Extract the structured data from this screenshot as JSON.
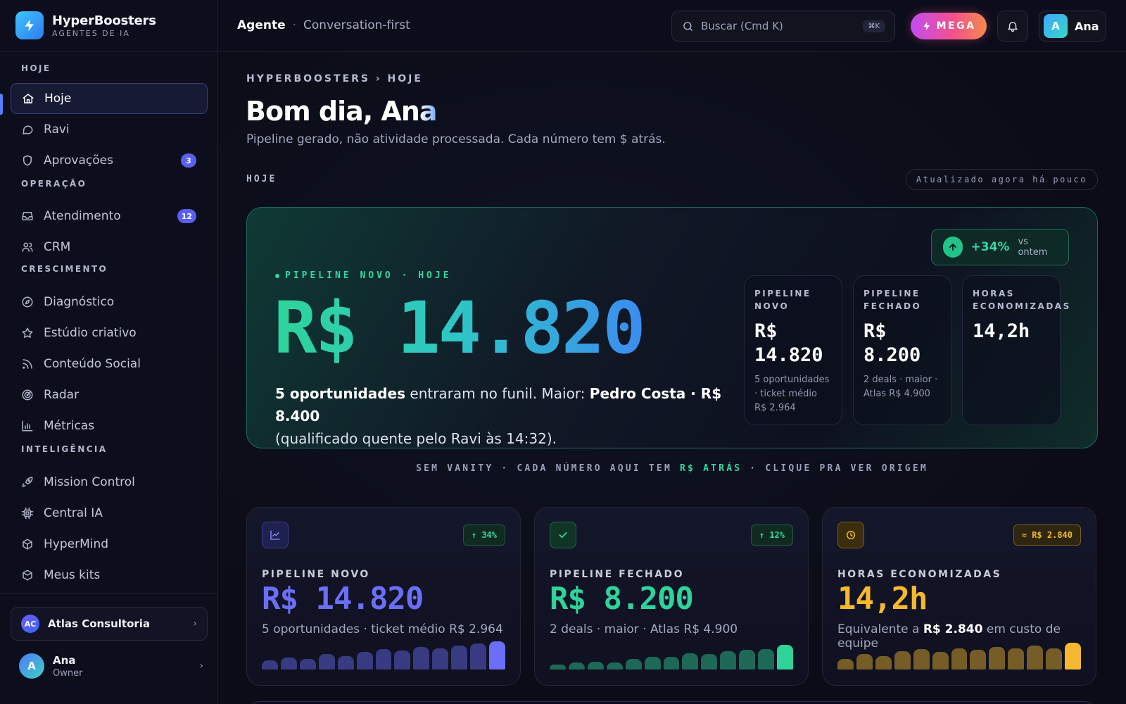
{
  "app": {
    "name": "HyperBoosters",
    "tagline": "AGENTES DE IA"
  },
  "sidebar": {
    "sections": [
      {
        "label": "HOJE"
      },
      {
        "label": "OPERAÇÃO"
      },
      {
        "label": "CRESCIMENTO"
      },
      {
        "label": "INTELIGÊNCIA"
      }
    ],
    "items": [
      {
        "label": "Hoje",
        "icon": "home-icon",
        "active": true
      },
      {
        "label": "Ravi",
        "icon": "chat-bubble-icon"
      },
      {
        "label": "Aprovações",
        "icon": "shield-icon",
        "badge": "3"
      },
      {
        "label": "Atendimento",
        "icon": "inbox-icon",
        "badge": "12"
      },
      {
        "label": "CRM",
        "icon": "users-icon"
      },
      {
        "label": "Diagnóstico",
        "icon": "compass-icon"
      },
      {
        "label": "Estúdio criativo",
        "icon": "star-icon"
      },
      {
        "label": "Conteúdo Social",
        "icon": "rss-icon"
      },
      {
        "label": "Radar",
        "icon": "radar-icon"
      },
      {
        "label": "Métricas",
        "icon": "bar-chart-icon"
      },
      {
        "label": "Mission Control",
        "icon": "rocket-icon"
      },
      {
        "label": "Central IA",
        "icon": "cpu-icon"
      },
      {
        "label": "HyperMind",
        "icon": "cube-icon"
      },
      {
        "label": "Meus kits",
        "icon": "box-icon"
      }
    ],
    "workspace": {
      "initials": "AC",
      "name": "Atlas Consultoria"
    },
    "user": {
      "initial": "A",
      "name": "Ana",
      "role": "Owner"
    }
  },
  "topbar": {
    "title": "Agente",
    "separator": "·",
    "mode": "Conversation-first",
    "search_placeholder": "Buscar (Cmd K)",
    "search_shortcut": "⌘K",
    "mega_label": "MEGA",
    "user_initial": "A",
    "user_name": "Ana"
  },
  "main": {
    "breadcrumb": "HYPERBOOSTERS › HOJE",
    "greeting_prefix": "Bom dia, An",
    "greeting_suffix": "a",
    "subtitle": "Pipeline gerado, não atividade processada. Cada número tem $ atrás.",
    "section_label": "HOJE",
    "updated": "Atualizado agora há pouco"
  },
  "hero": {
    "label": "PIPELINE NOVO · HOJE",
    "value": "R$ 14.820",
    "change_value": "+34%",
    "change_label": "vs ontem",
    "desc_count": "5 oportunidades",
    "desc_mid": " entraram no funil. Maior: ",
    "desc_top": "Pedro Costa · R$ 8.400",
    "desc_end": "(qualificado quente pelo Ravi às 14:32).",
    "stats": [
      {
        "title": "PIPELINE NOVO",
        "value": "R$ 14.820",
        "desc": "5 oportunidades · ticket médio R$ 2.964"
      },
      {
        "title": "PIPELINE FECHADO",
        "value": "R$ 8.200",
        "desc": "2 deals · maior · Atlas R$ 4.900"
      },
      {
        "title": "HORAS ECONOMIZADAS",
        "value": "14,2h",
        "desc": ""
      }
    ]
  },
  "vanity": {
    "prefix": "SEM VANITY · CADA NÚMERO AQUI TEM ",
    "highlight": "R$ ATRÁS",
    "suffix": " · CLIQUE PRA VER ORIGEM"
  },
  "kpis": [
    {
      "title": "PIPELINE NOVO",
      "value": "R$ 14.820",
      "chip": "↑ 34%",
      "desc": "5 oportunidades · ticket médio R$ 2.964",
      "icon": "line-chart-icon",
      "accent": "#6b6ef6",
      "bars": [
        0.32,
        0.42,
        0.38,
        0.55,
        0.48,
        0.62,
        0.72,
        0.68,
        0.8,
        0.75,
        0.85,
        0.92,
        1.0
      ]
    },
    {
      "title": "PIPELINE FECHADO",
      "value": "R$ 8.200",
      "chip": "↑ 12%",
      "desc": "2 deals · maior · Atlas R$ 4.900",
      "icon": "check-icon",
      "accent": "#2fd39a",
      "bars": [
        0.18,
        0.26,
        0.28,
        0.24,
        0.38,
        0.46,
        0.44,
        0.58,
        0.54,
        0.66,
        0.7,
        0.72,
        0.88
      ]
    },
    {
      "title": "HORAS ECONOMIZADAS",
      "value": "14,2h",
      "chip": "≈ R$ 2.840",
      "desc_prefix": "Equivalente a ",
      "desc_bold": "R$ 2.840",
      "desc_suffix": " em custo de equipe",
      "icon": "clock-icon",
      "accent": "#f5b82e",
      "bars": [
        0.38,
        0.55,
        0.48,
        0.66,
        0.72,
        0.62,
        0.74,
        0.7,
        0.8,
        0.76,
        0.84,
        0.74,
        0.95
      ]
    }
  ]
}
